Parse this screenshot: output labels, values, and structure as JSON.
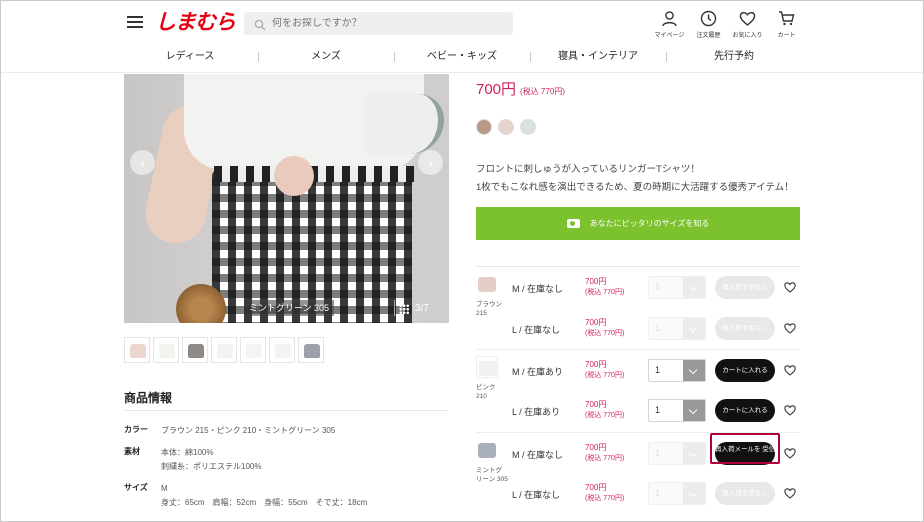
{
  "header": {
    "logo": "しまむら",
    "search_placeholder": "何をお探しですか？",
    "icons": [
      {
        "icon": "person-icon",
        "label": "マイページ"
      },
      {
        "icon": "clock-icon",
        "label": "注文履歴"
      },
      {
        "icon": "heart-icon",
        "label": "お気に入り"
      },
      {
        "icon": "cart-icon",
        "label": "カート"
      }
    ]
  },
  "nav": [
    "レディース",
    "メンズ",
    "ベビー・キッズ",
    "寝具・インテリア",
    "先行予約"
  ],
  "gallery": {
    "caption": "ミントグリーン 305",
    "counter": "3/7",
    "thumb_colors": [
      "#ead6cf",
      "#f3f2ef",
      "#d7d3cc",
      "#f2f2f2",
      "#f4f4f4",
      "#f3f3f3",
      "#b9bcc4"
    ]
  },
  "product": {
    "price": "700円",
    "price_tax": "(税込 770円)",
    "swatch_colors": [
      "#b89887",
      "#e6d3ce",
      "#d8e1df"
    ],
    "description": [
      "フロントに刺しゅうが入っているリンガーTシャツ！",
      "1枚でもこなれ感を演出できるため、夏の時期に大活躍する優秀アイテム！"
    ],
    "size_button": "あなたにピッタリのサイズを知る"
  },
  "info": {
    "title": "商品情報",
    "rows": [
      {
        "key": "カラー",
        "values": [
          "ブラウン 215・ピンク 210・ミントグリーン 305"
        ]
      },
      {
        "key": "素材",
        "values": [
          "本体：綿100%",
          "刺繍糸：ポリエステル100%"
        ]
      },
      {
        "key": "サイズ",
        "values": [
          "M",
          "身丈：65cm　肩幅：52cm　身幅：55cm　そで丈：18cm"
        ]
      }
    ]
  },
  "variants": [
    {
      "color_label": "ブラウン 215",
      "thumb_color": "#e4cfc6",
      "size": "M / 在庫なし",
      "price": "700円",
      "tax": "(税込 770円)",
      "qty": "1",
      "qty_state": "disabled",
      "action": "再入荷予定なし",
      "action_style": "gray"
    },
    {
      "color_label": "",
      "thumb_color": "",
      "size": "L / 在庫なし",
      "price": "700円",
      "tax": "(税込 770円)",
      "qty": "1",
      "qty_state": "disabled",
      "action": "再入荷予定なし",
      "action_style": "gray"
    },
    {
      "color_label": "ピンク 210",
      "thumb_color": "#f1f1f1",
      "size": "M / 在庫あり",
      "price": "700円",
      "tax": "(税込 770円)",
      "qty": "1",
      "qty_state": "enabled",
      "action": "カートに入れる",
      "action_style": "black"
    },
    {
      "color_label": "",
      "thumb_color": "",
      "size": "L / 在庫あり",
      "price": "700円",
      "tax": "(税込 770円)",
      "qty": "1",
      "qty_state": "enabled",
      "action": "カートに入れる",
      "action_style": "black"
    },
    {
      "color_label": "ミントグリーン 305",
      "thumb_color": "#b7bcc3",
      "size": "M / 在庫なし",
      "price": "700円",
      "tax": "(税込 770円)",
      "qty": "1",
      "qty_state": "disabled",
      "action": "再入荷メールを 受信する",
      "action_style": "black2",
      "highlighted": true
    },
    {
      "color_label": "",
      "thumb_color": "",
      "size": "L / 在庫なし",
      "price": "700円",
      "tax": "(税込 770円)",
      "qty": "1",
      "qty_state": "disabled",
      "action": "再入荷予定なし",
      "action_style": "gray"
    }
  ]
}
